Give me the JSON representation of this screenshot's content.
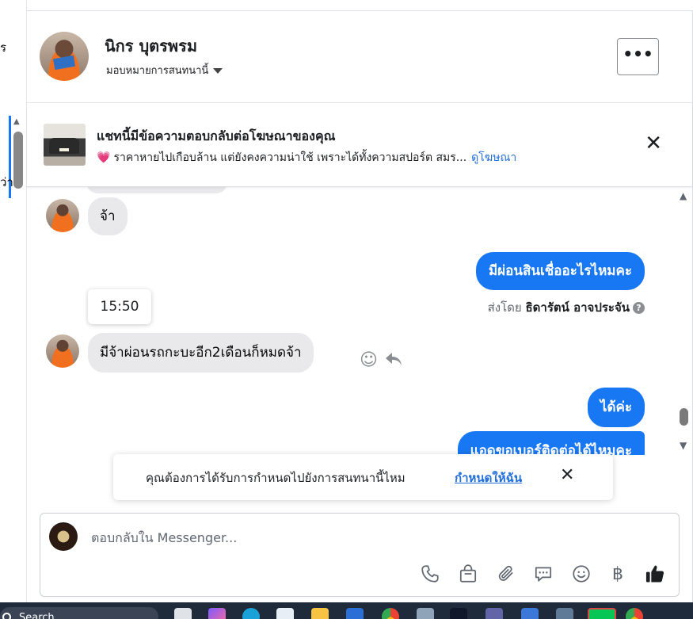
{
  "left_pane": {
    "fragment_top": "ร",
    "fragment_mid": "ว่า"
  },
  "header": {
    "name": "นิกร บุตรพรม",
    "assign_label": "มอบหมายการสนทนานี้",
    "more_label": "•••"
  },
  "ad": {
    "title": "แชทนี้มีข้อความตอบกลับต่อโฆษณาของคุณ",
    "heart": "💗",
    "snippet": "ราคาหายไปเกือบล้าน แต่ยังคงความน่าใช้ เพราะได้ทั้งความสปอร์ต สมร...",
    "link": "ดูโฆษณา",
    "close": "✕"
  },
  "messages": {
    "m1": "จ้า",
    "m2": "มีผ่อนสินเชื่ออะไรไหมคะ",
    "sent_by_prefix": "ส่งโดย",
    "sent_by_name": "ธิดารัตน์ อาจประจัน",
    "sent_by_help": "?",
    "time": "15:50",
    "m3": "มีจ้าผ่อนรถกะบะอีก2เดือนก็หมดจ้า",
    "m4": "ได้ค่ะ",
    "m5": "แอดขอเบอร์ติดต่อได้ไหมคะ"
  },
  "toast": {
    "text": "คุณต้องการได้รับการกำหนดไปยังการสนทนานี้ไหม",
    "link": "กำหนดให้ฉัน",
    "close": "✕"
  },
  "composer": {
    "placeholder": "ตอบกลับใน Messenger...",
    "tools": [
      "phone-icon",
      "shopping-bag-icon",
      "paperclip-icon",
      "quick-reply-icon",
      "emoji-icon",
      "baht-icon",
      "thumbs-up-icon"
    ],
    "baht": "฿"
  },
  "taskbar": {
    "search_label": "Search"
  },
  "colors": {
    "accent": "#1877f2",
    "bubble_in": "#e9e9eb",
    "link": "#216fdb"
  }
}
